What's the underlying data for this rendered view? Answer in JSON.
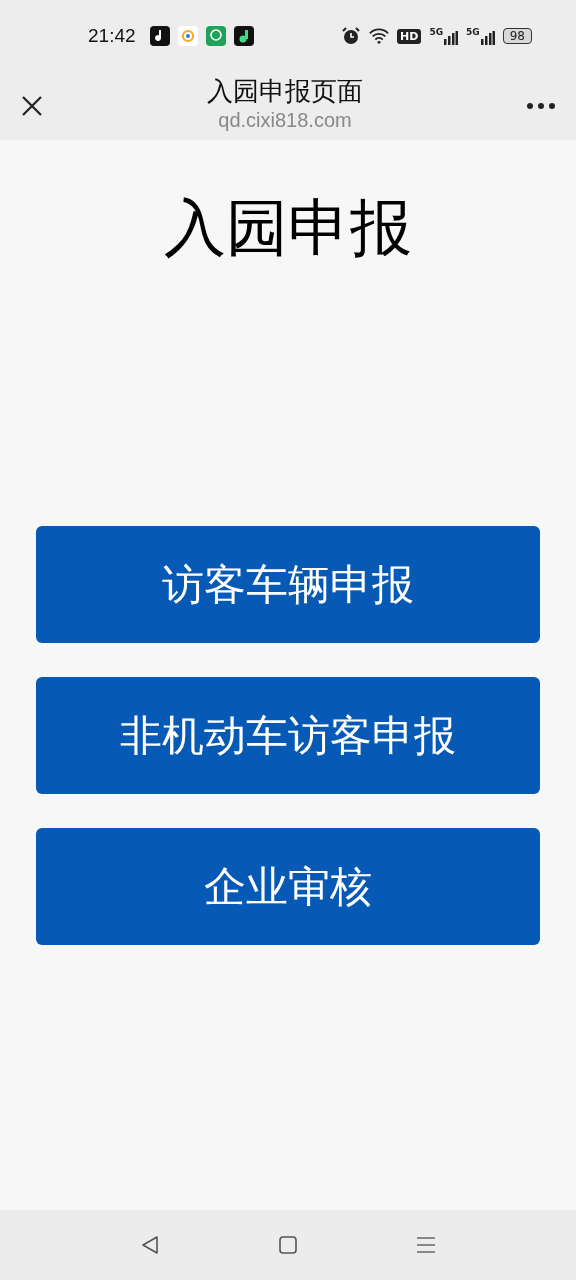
{
  "status_bar": {
    "time": "21:42",
    "hd": "HD",
    "signals": [
      "5G",
      "5G"
    ],
    "battery": "98"
  },
  "header": {
    "title": "入园申报页面",
    "url": "qd.cixi818.com"
  },
  "page": {
    "heading": "入园申报",
    "buttons": [
      "访客车辆申报",
      "非机动车访客申报",
      "企业审核"
    ]
  }
}
